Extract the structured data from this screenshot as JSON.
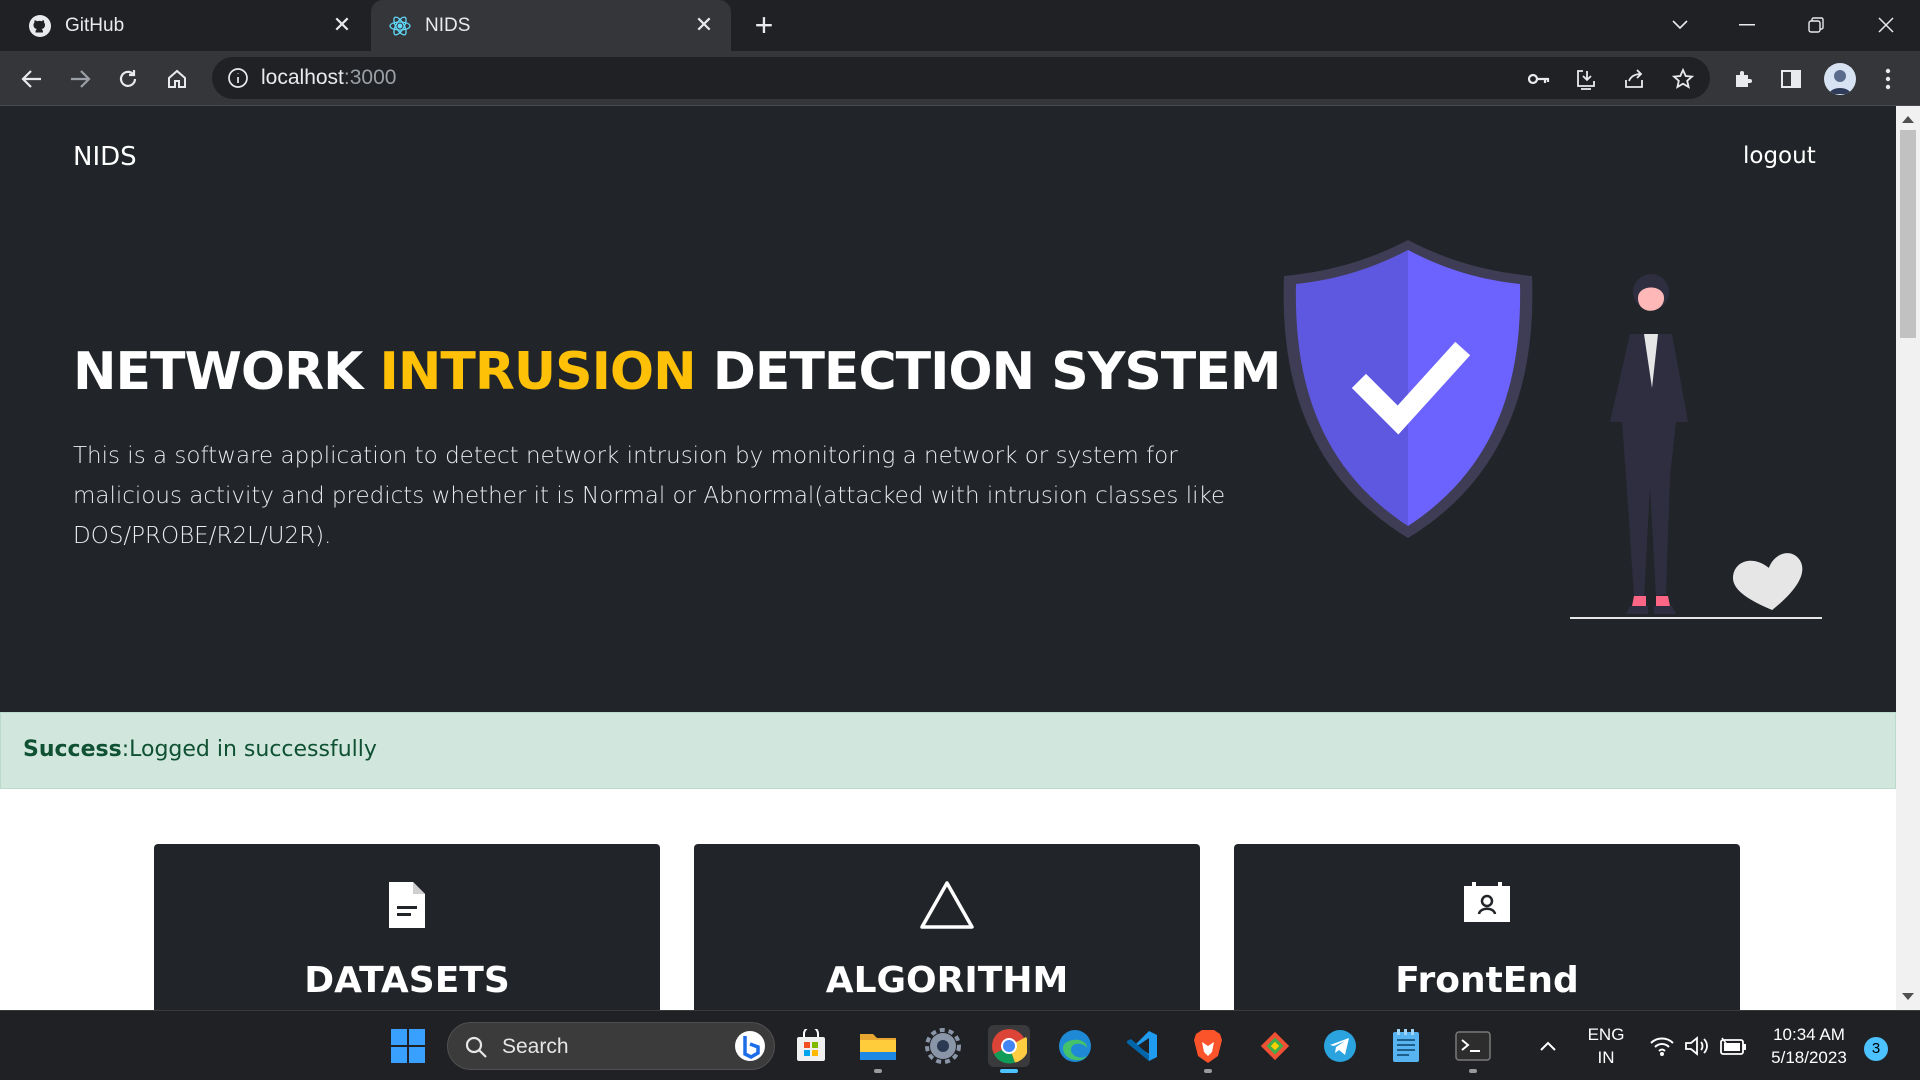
{
  "browser": {
    "tabs": [
      {
        "title": "GitHub",
        "favicon": "github-icon"
      },
      {
        "title": "NIDS",
        "favicon": "react-icon"
      }
    ],
    "url_host": "localhost",
    "url_port": ":3000"
  },
  "page": {
    "brand": "NIDS",
    "logout": "logout",
    "title_part1": "NETWORK ",
    "title_accent": "INTRUSION",
    "title_part2": " DETECTION SYSTEM",
    "description": "This is a software application to detect network intrusion by monitoring a network or system for malicious activity and predicts whether it is Normal or Abnormal(attacked with intrusion classes like DOS/PROBE/R2L/U2R).",
    "alert_strong": "Success",
    "alert_text": ":Logged in successfully",
    "cards": [
      {
        "label": "DATASETS",
        "icon": "document-icon"
      },
      {
        "label": "ALGORITHM",
        "icon": "triangle-icon"
      },
      {
        "label": "FrontEnd",
        "icon": "calendar-user-icon"
      }
    ],
    "colors": {
      "hero_bg": "#212529",
      "accent": "#ffc107",
      "alert_bg": "#d1e7dd",
      "shield": "#6c63ff"
    }
  },
  "taskbar": {
    "search_placeholder": "Search",
    "lang_line1": "ENG",
    "lang_line2": "IN",
    "time": "10:34 AM",
    "date": "5/18/2023",
    "notification_count": "3"
  }
}
